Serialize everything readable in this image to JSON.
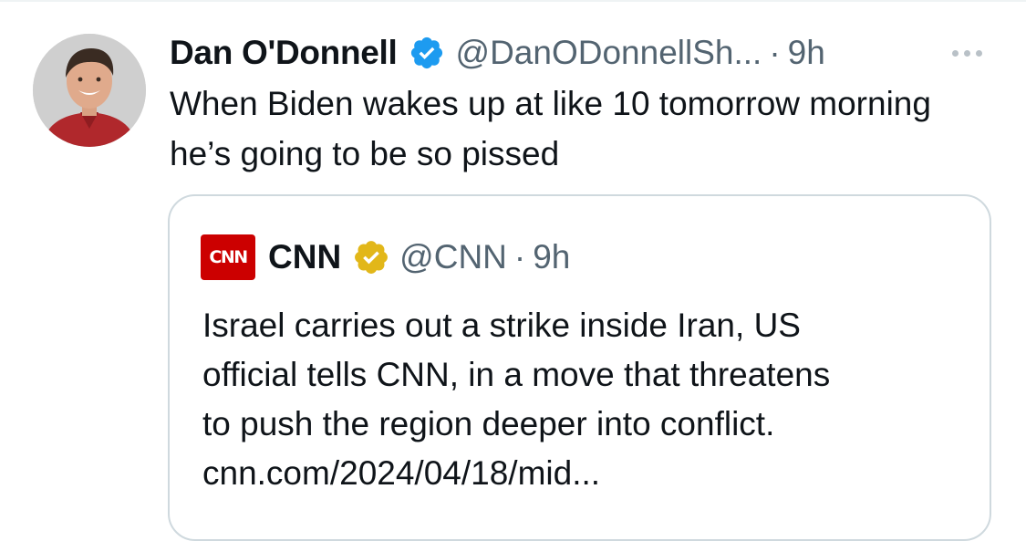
{
  "tweet": {
    "author_name": "Dan O'Donnell",
    "author_handle": "@DanODonnellSh...",
    "separator": "·",
    "time": "9h",
    "text": "When Biden wakes up at like 10 tomorrow morning he’s going to be so pissed",
    "verified_color": "#1d9bf0",
    "more_icon": "ellipsis-icon"
  },
  "quote": {
    "logo_text": "CNN",
    "author_name": "CNN",
    "author_handle": "@CNN",
    "separator": "·",
    "time": "9h",
    "badge_color": "#e2b719",
    "lines": [
      "Israel carries out a strike inside Iran, US",
      "official tells CNN, in a move that threatens",
      "to push the region deeper into conflict.",
      "cnn.com/2024/04/18/mid..."
    ]
  }
}
